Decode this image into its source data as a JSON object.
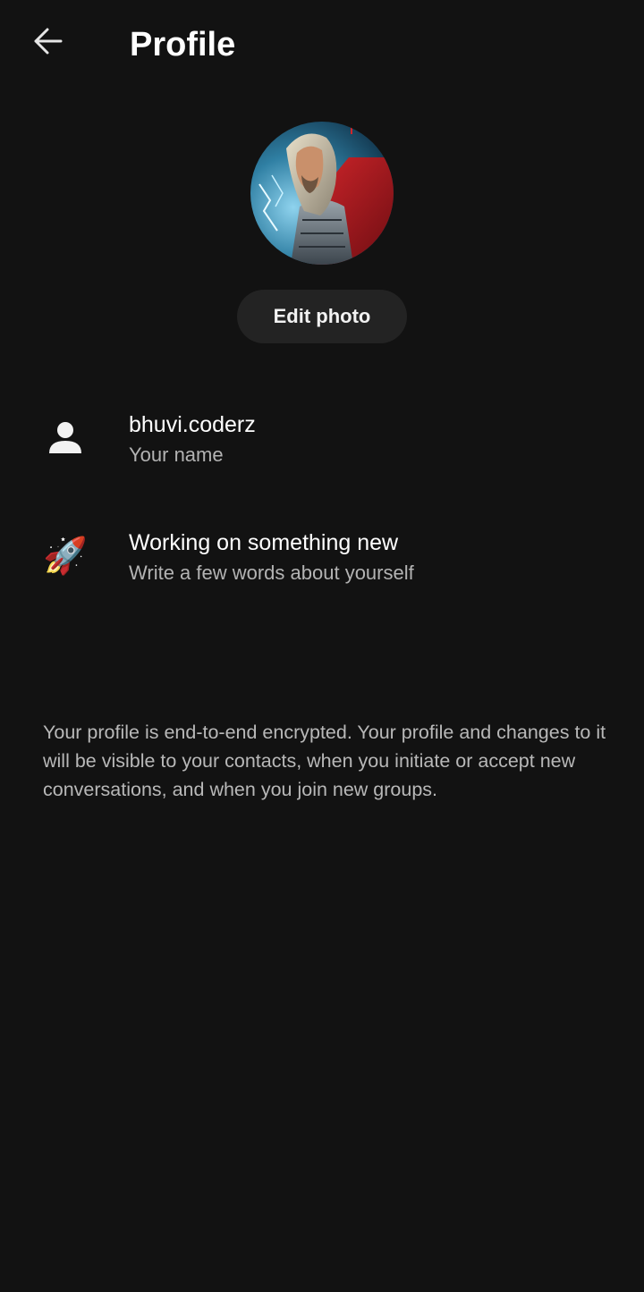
{
  "header": {
    "title": "Profile",
    "back_icon": "arrow-left-icon"
  },
  "avatar": {
    "description_icon": "profile-photo"
  },
  "edit_photo": {
    "label": "Edit photo"
  },
  "name_row": {
    "icon": "person-icon",
    "value": "bhuvi.coderz",
    "hint": "Your name"
  },
  "about_row": {
    "icon": "rocket-emoji",
    "emoji": "🚀",
    "value": "Working on something new",
    "hint": "Write a few words about yourself"
  },
  "footer": {
    "note": "Your profile is end-to-end encrypted. Your profile and changes to it will be visible to your contacts, when you initiate or accept new conversations, and when you join new groups."
  },
  "colors": {
    "background": "#121212",
    "button_bg": "#232323",
    "secondary_text": "#b3b3b3"
  }
}
